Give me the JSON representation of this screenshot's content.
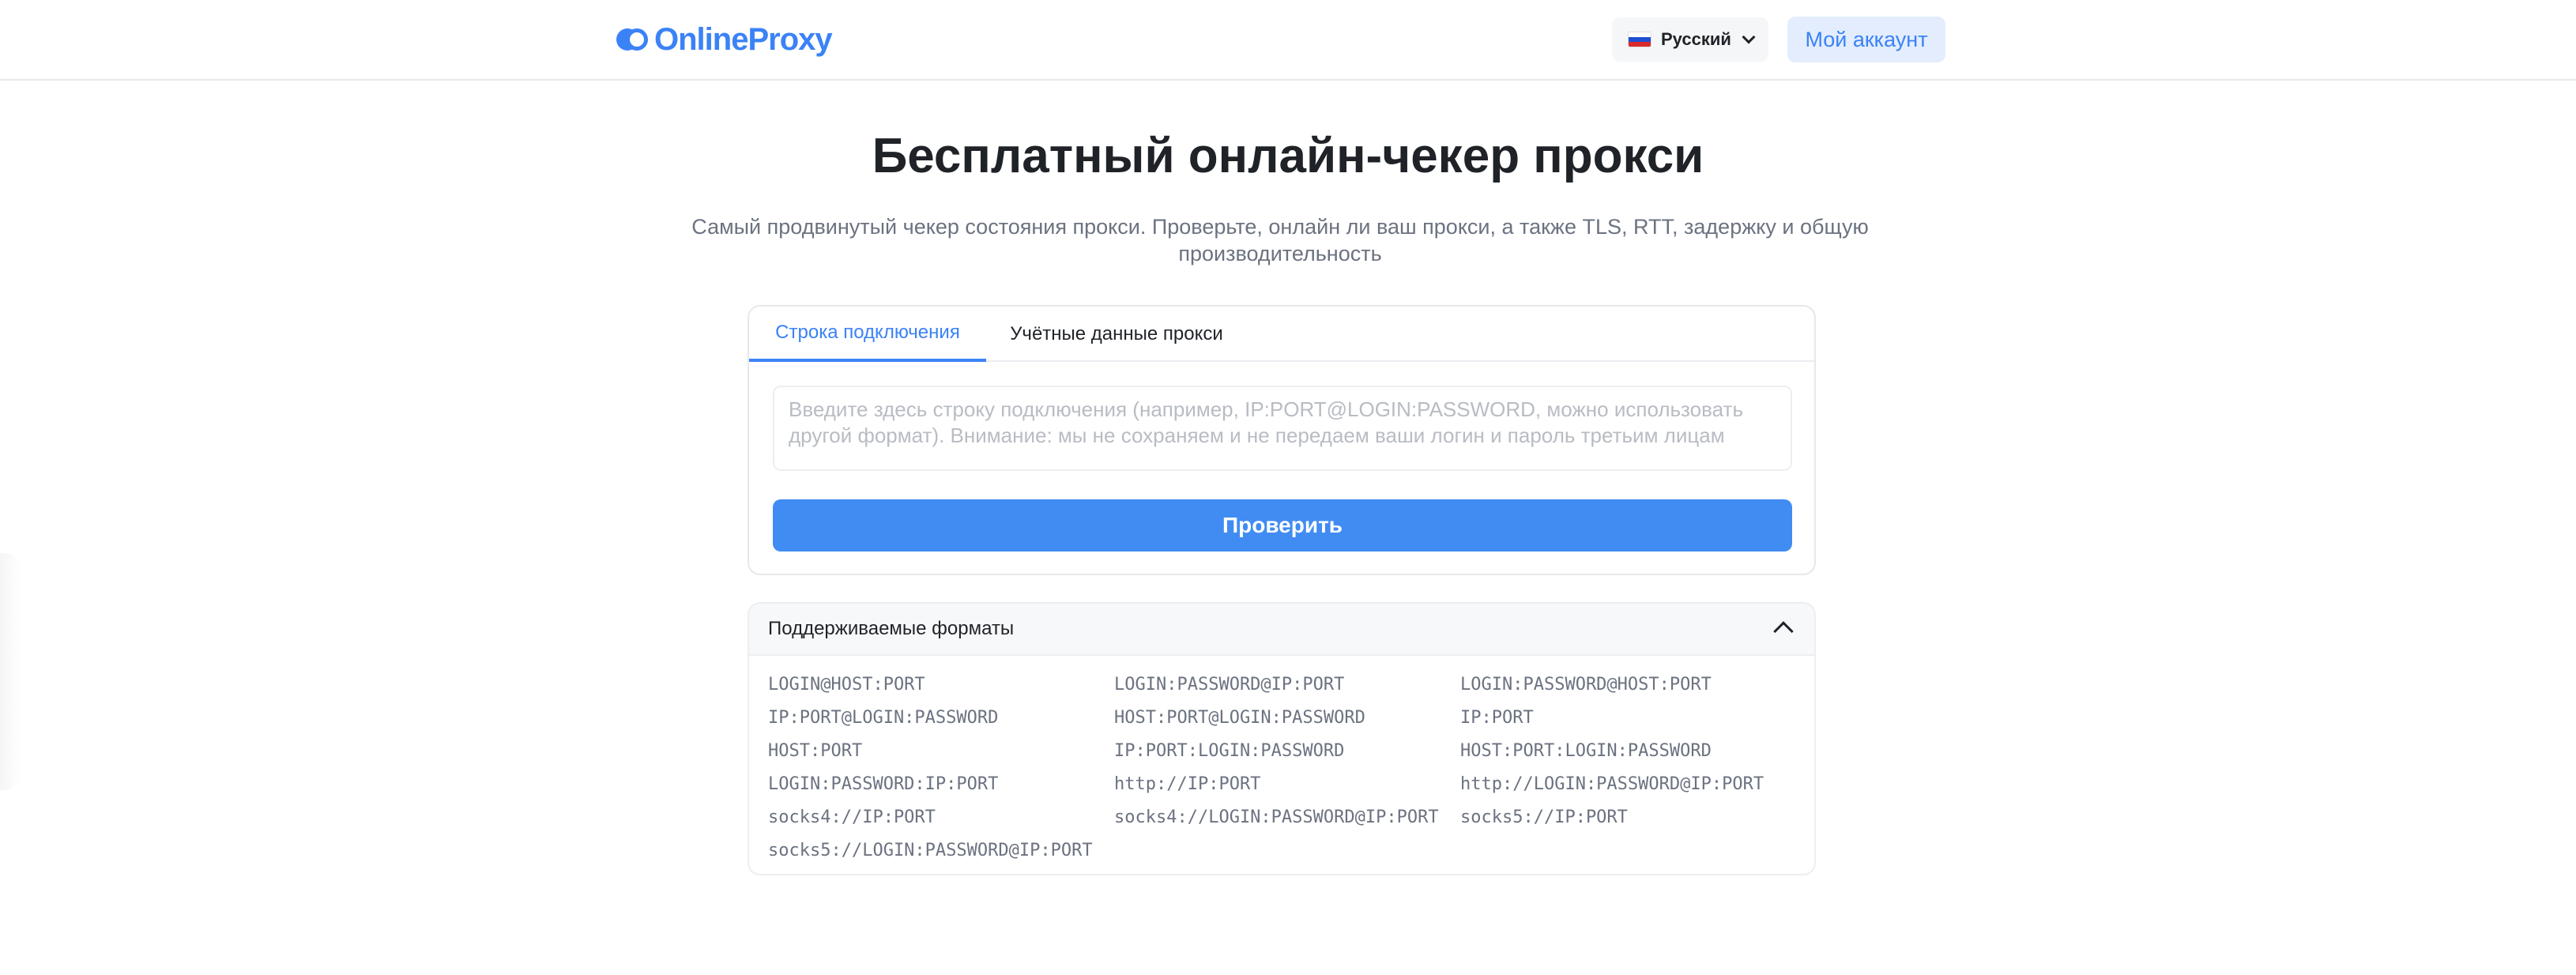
{
  "header": {
    "logo_text": "OnlineProxy",
    "language": {
      "flag_icon": "russia-flag-icon",
      "label": "Русский"
    },
    "account_label": "Мой аккаунт"
  },
  "hero": {
    "title": "Бесплатный онлайн-чекер прокси",
    "subtitle": "Самый продвинутый чекер состояния прокси. Проверьте, онлайн ли ваш прокси, а также TLS, RTT, задержку и общую производительность"
  },
  "checker": {
    "tabs": [
      {
        "label": "Строка подключения",
        "active": true
      },
      {
        "label": "Учётные данные прокси",
        "active": false
      }
    ],
    "input": {
      "value": "",
      "placeholder": "Введите здесь строку подключения (например, IP:PORT@LOGIN:PASSWORD, можно использовать другой формат). Внимание: мы не сохраняем и не передаем ваши логин и пароль третьим лицам"
    },
    "submit_label": "Проверить"
  },
  "formats": {
    "title": "Поддерживаемые форматы",
    "expanded": true,
    "items": [
      "LOGIN@HOST:PORT",
      "LOGIN:PASSWORD@IP:PORT",
      "LOGIN:PASSWORD@HOST:PORT",
      "IP:PORT@LOGIN:PASSWORD",
      "HOST:PORT@LOGIN:PASSWORD",
      "IP:PORT",
      "HOST:PORT",
      "IP:PORT:LOGIN:PASSWORD",
      "HOST:PORT:LOGIN:PASSWORD",
      "LOGIN:PASSWORD:IP:PORT",
      "http://IP:PORT",
      "http://LOGIN:PASSWORD@IP:PORT",
      "socks4://IP:PORT",
      "socks4://LOGIN:PASSWORD@IP:PORT",
      "socks5://IP:PORT",
      "socks5://LOGIN:PASSWORD@IP:PORT"
    ]
  },
  "colors": {
    "accent": "#3b82f6",
    "button": "#418cf2",
    "account_bg": "#e3edfd",
    "muted_text": "#6b7280"
  }
}
